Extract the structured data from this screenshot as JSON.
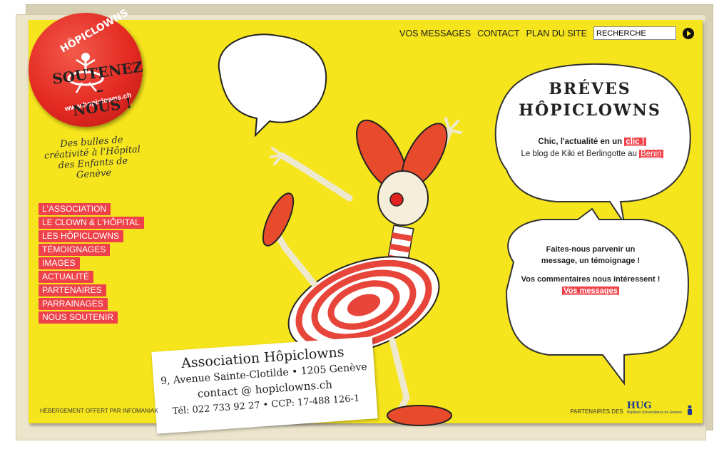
{
  "site": {
    "badge_name": "HÔPICLOWNS",
    "badge_url": "www.hopiclowns.ch",
    "tagline": "Des bulles de créativité à l'Hôpital des Enfants de Genève"
  },
  "top_nav": {
    "messages": "VOS MESSAGES",
    "contact": "CONTACT",
    "sitemap": "PLAN DU SITE",
    "search_value": "RECHERCHE"
  },
  "side_nav": [
    "L'ASSOCIATION",
    "LE CLOWN & L'HÔPITAL",
    "LES HÔPICLOWNS",
    "TÉMOIGNAGES",
    "IMAGES",
    "ACTUALITÉ",
    "PARTENAIRES",
    "PARRAINAGES",
    "NOUS SOUTENIR"
  ],
  "support_bubble": {
    "line1": "SOUTENEZ",
    "line2": "–",
    "line3": "NOUS !"
  },
  "breves": {
    "title_line1": "BRÉVES",
    "title_line2": "HÔPICLOWNS",
    "news1_text": "Chic, l'actualité en un ",
    "news1_link": "clic !",
    "news2_text": "Le blog de Kiki et Berlingotte au ",
    "news2_link": "Benin"
  },
  "messages_box": {
    "line1": "Faites-nous parvenir un",
    "line2": "message, un témoignage !",
    "line3": "Vos commentaires nous intéressent !",
    "link": "Vos messages"
  },
  "address": {
    "name": "Association Hôpiclowns",
    "street": "9, Avenue Sainte-Clotilde • 1205 Genève",
    "email": "contact @ hopiclowns.ch",
    "phone": "Tél: 022 733 92 27 • CCP: 17-488 126-1"
  },
  "footer": {
    "hosting": "HÉBERGEMENT OFFERT PAR INFOMANIAK",
    "partners": "PARTENAIRES DES",
    "hug": "HUG",
    "hug_sub": "Hôpitaux Universitaires de Genève"
  },
  "colors": {
    "background": "#f6e51c",
    "accent": "#ef4149",
    "badge": "#e42a23"
  }
}
